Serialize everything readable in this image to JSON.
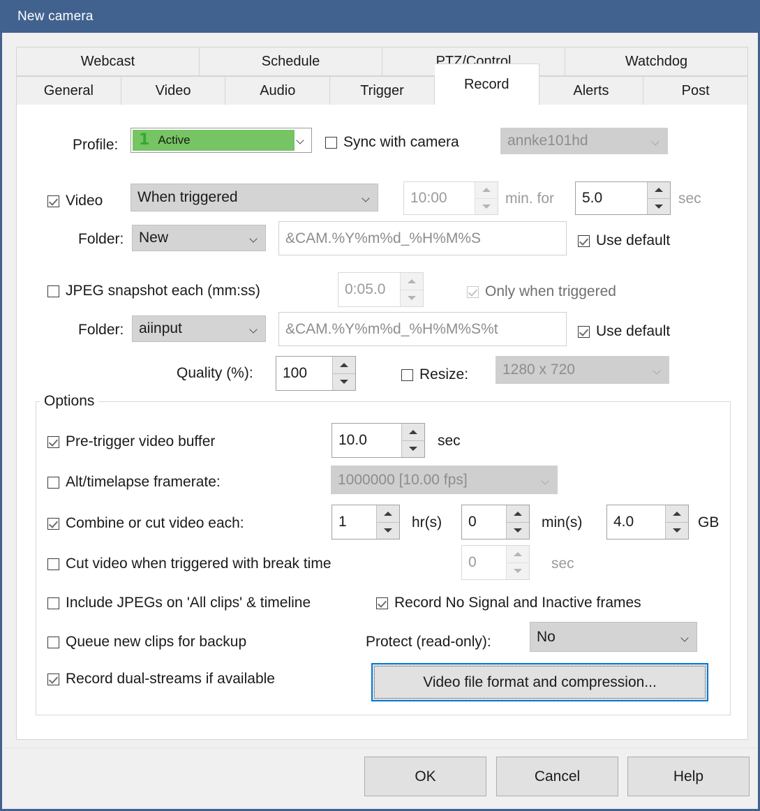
{
  "window": {
    "title": "New camera"
  },
  "tabs": {
    "row1": [
      {
        "label": "Webcast",
        "selected": false
      },
      {
        "label": "Schedule",
        "selected": false
      },
      {
        "label": "PTZ/Control",
        "selected": false
      },
      {
        "label": "Watchdog",
        "selected": false
      }
    ],
    "row2": [
      {
        "label": "General",
        "selected": false
      },
      {
        "label": "Video",
        "selected": false
      },
      {
        "label": "Audio",
        "selected": false
      },
      {
        "label": "Trigger",
        "selected": false
      },
      {
        "label": "Record",
        "selected": true
      },
      {
        "label": "Alerts",
        "selected": false
      },
      {
        "label": "Post",
        "selected": false
      }
    ]
  },
  "record": {
    "profile": {
      "label": "Profile:",
      "number": "1",
      "value": "Active",
      "accent_color": "#76c463"
    },
    "sync_with_camera": {
      "label": "Sync with camera",
      "checked": false
    },
    "camera_select": {
      "value": "annke101hd",
      "enabled": false
    },
    "video": {
      "label": "Video",
      "checked": true,
      "mode": "When triggered",
      "minutes_value": "10:00",
      "minutes_label": "min. for",
      "seconds_value": "5.0",
      "seconds_label": "sec"
    },
    "video_folder": {
      "label": "Folder:",
      "value": "New",
      "pattern": "&CAM.%Y%m%d_%H%M%S",
      "use_default_label": "Use default",
      "use_default_checked": true
    },
    "jpeg_snapshot": {
      "label": "JPEG snapshot each (mm:ss)",
      "checked": false,
      "interval": "0:05.0",
      "only_when_triggered_label": "Only when triggered",
      "only_when_triggered_checked": true
    },
    "jpeg_folder": {
      "label": "Folder:",
      "value": "aiinput",
      "pattern": "&CAM.%Y%m%d_%H%M%S%t",
      "use_default_label": "Use default",
      "use_default_checked": true
    },
    "quality": {
      "label": "Quality (%):",
      "value": "100"
    },
    "resize": {
      "label": "Resize:",
      "checked": false,
      "value": "1280 x 720"
    },
    "options": {
      "title": "Options",
      "pre_trigger": {
        "label": "Pre-trigger video buffer",
        "checked": true,
        "value": "10.0",
        "unit": "sec"
      },
      "alt_framerate": {
        "label": "Alt/timelapse framerate:",
        "checked": false,
        "value": "1000000 [10.00 fps]"
      },
      "combine_cut": {
        "label": "Combine or cut video each:",
        "checked": true,
        "hours": "1",
        "hours_unit": "hr(s)",
        "minutes": "0",
        "minutes_unit": "min(s)",
        "size": "4.0",
        "size_unit": "GB"
      },
      "cut_on_trigger": {
        "label": "Cut video when triggered with break time",
        "checked": false,
        "value": "0",
        "unit": "sec"
      },
      "include_jpegs": {
        "label": "Include JPEGs on 'All clips' & timeline",
        "checked": false
      },
      "record_no_signal": {
        "label": "Record No Signal and Inactive frames",
        "checked": true
      },
      "queue_backup": {
        "label": "Queue new clips for backup",
        "checked": false
      },
      "protect": {
        "label": "Protect (read-only):",
        "value": "No"
      },
      "dual_streams": {
        "label": "Record dual-streams if available",
        "checked": true
      },
      "video_format_button": {
        "label": "Video file format and compression...",
        "focused": true
      }
    }
  },
  "footer": {
    "ok": "OK",
    "cancel": "Cancel",
    "help": "Help"
  }
}
